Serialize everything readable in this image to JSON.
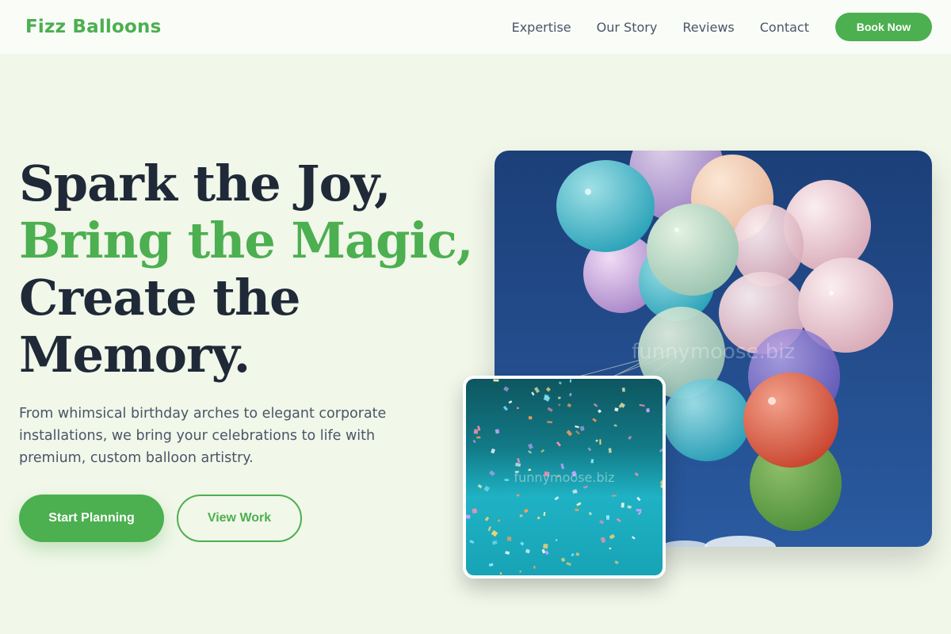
{
  "brand": {
    "name": "Fizz Balloons",
    "accent": "#4caf50",
    "text_dark": "#1f2937"
  },
  "nav": {
    "links": [
      "Expertise",
      "Our Story",
      "Reviews",
      "Contact"
    ],
    "cta": "Book Now"
  },
  "hero": {
    "headline_1": "Spark the Joy,",
    "headline_2": "Bring the Magic,",
    "headline_3": "Create the",
    "headline_4": "Memory.",
    "subtitle": "From whimsical birthday arches to elegant corporate installations, we bring your celebrations to life with premium, custom balloon artistry.",
    "primary_cta": "Start Planning",
    "secondary_cta": "View Work"
  },
  "images": {
    "main": "balloons-photo",
    "secondary": "confetti-photo",
    "watermark": "funnymoose.biz"
  }
}
